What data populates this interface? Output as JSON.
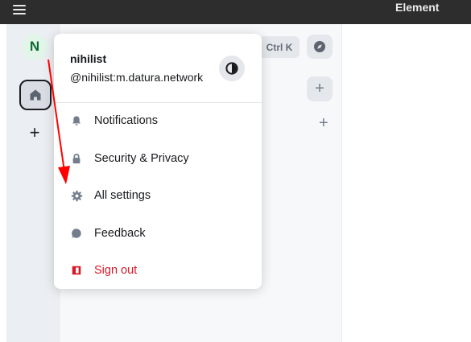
{
  "app": {
    "title": "Element"
  },
  "spacebar": {
    "avatar_letter": "N"
  },
  "roomlist": {
    "shortcut_chip": "Ctrl K"
  },
  "user_menu": {
    "display_name": "nihilist",
    "user_id": "@nihilist:m.datura.network",
    "items": [
      {
        "label": "Notifications",
        "icon": "bell-icon"
      },
      {
        "label": "Security & Privacy",
        "icon": "lock-icon"
      },
      {
        "label": "All settings",
        "icon": "gear-icon"
      },
      {
        "label": "Feedback",
        "icon": "chat-bubble-icon"
      },
      {
        "label": "Sign out",
        "icon": "sign-out-icon"
      }
    ]
  },
  "colors": {
    "titlebar": "#2d2d2d",
    "spacebar": "#ebeef2",
    "roomlist": "#f7f8fa",
    "menu_icon": "#737d8c",
    "danger": "#d51928",
    "avatar_bg": "#e1f5e8",
    "avatar_fg": "#0e6a2f",
    "annotation_arrow": "#ff0000"
  }
}
